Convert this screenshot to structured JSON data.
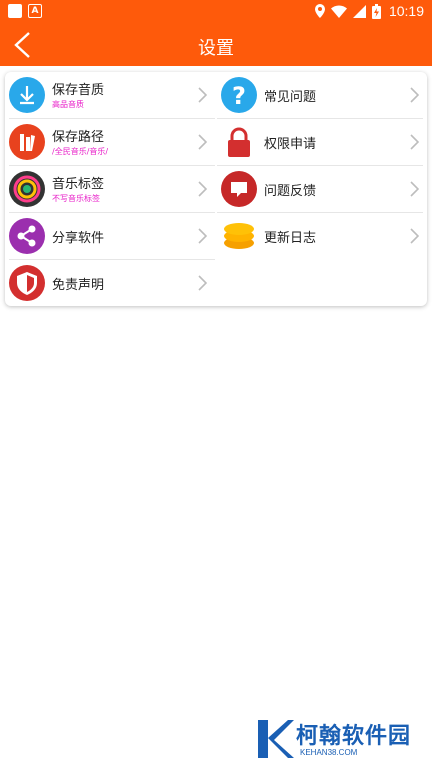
{
  "status_bar": {
    "time": "10:19",
    "icons": [
      "notification-square-icon",
      "a-badge-icon",
      "location-icon",
      "wifi-icon",
      "signal-icon",
      "battery-charging-icon"
    ]
  },
  "app_bar": {
    "title": "设置",
    "back_icon": "chevron-left-icon"
  },
  "colors": {
    "accent": "#fe5a0b",
    "subtitle": "#e81ec8",
    "chevron": "#bdbdbd"
  },
  "settings": {
    "left": [
      {
        "label": "保存音质",
        "sub": "高品音质",
        "icon": "download-icon"
      },
      {
        "label": "保存路径",
        "sub": "/全民音乐/音乐/",
        "icon": "folder-path-icon"
      },
      {
        "label": "音乐标签",
        "sub": "不写音乐标签",
        "icon": "music-tag-icon"
      },
      {
        "label": "分享软件",
        "sub": "",
        "icon": "share-icon"
      },
      {
        "label": "免责声明",
        "sub": "",
        "icon": "shield-icon"
      }
    ],
    "right": [
      {
        "label": "常见问题",
        "icon": "question-icon"
      },
      {
        "label": "权限申请",
        "icon": "lock-icon"
      },
      {
        "label": "问题反馈",
        "icon": "feedback-icon"
      },
      {
        "label": "更新日志",
        "icon": "database-log-icon"
      }
    ]
  },
  "watermark": {
    "text": "柯翰软件园",
    "sub": "KEHAN38.COM"
  }
}
